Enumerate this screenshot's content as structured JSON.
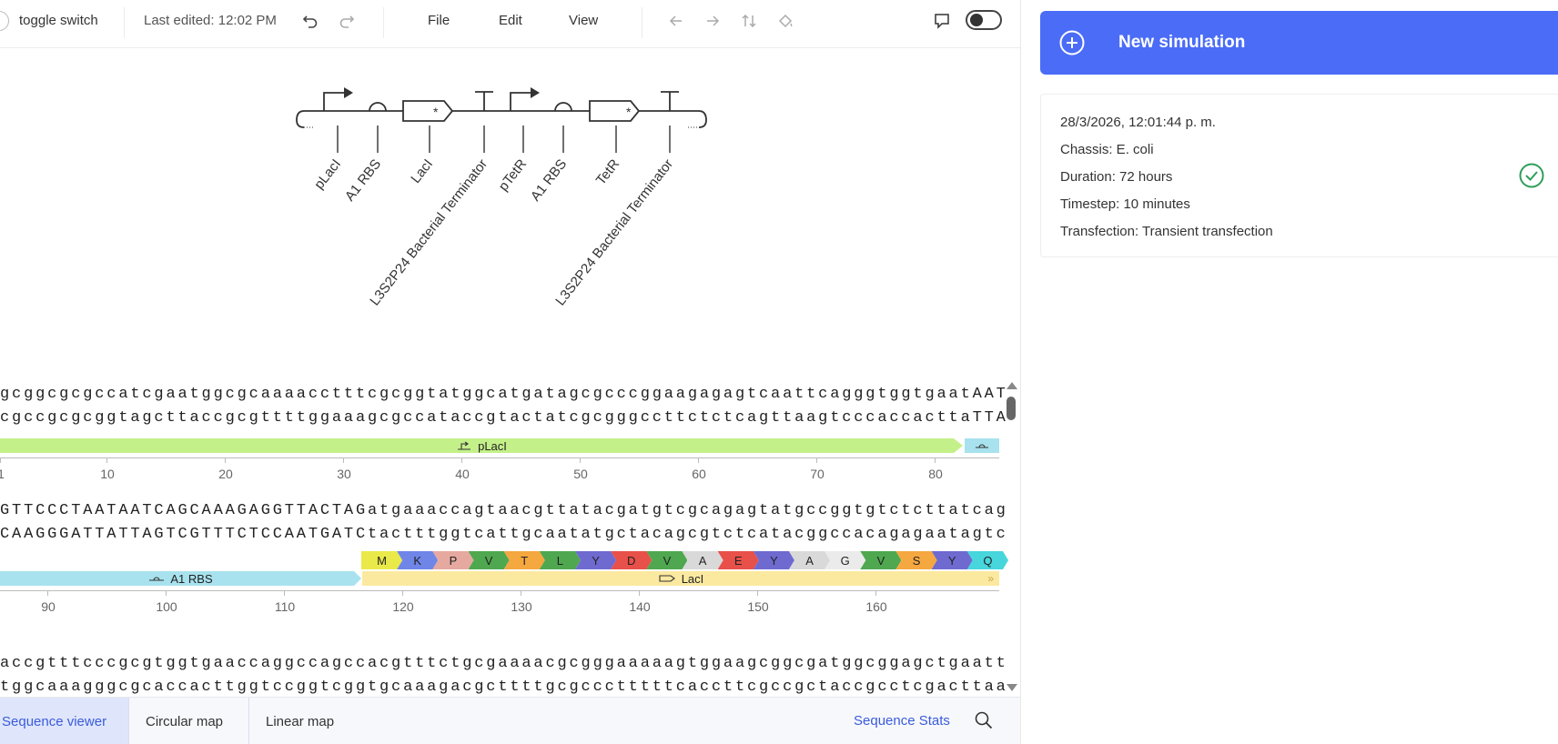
{
  "toolbar": {
    "design_name": "toggle switch",
    "last_edited": "Last edited: 12:02 PM",
    "menus": [
      "File",
      "Edit",
      "View"
    ]
  },
  "diagram": {
    "parts": [
      {
        "label": "pLacI",
        "kind": "promoter"
      },
      {
        "label": "A1 RBS",
        "kind": "rbs"
      },
      {
        "label": "LacI",
        "kind": "cds"
      },
      {
        "label": "L3S2P24 Bacterial Terminator",
        "kind": "terminator"
      },
      {
        "label": "pTetR",
        "kind": "promoter"
      },
      {
        "label": "A1 RBS",
        "kind": "rbs"
      },
      {
        "label": "TetR",
        "kind": "cds"
      },
      {
        "label": "L3S2P24 Bacterial Terminator",
        "kind": "terminator"
      }
    ]
  },
  "sequence": {
    "block1": {
      "top": "gcggcgcgccatcgaatggcgcaaaacctttcgcggtatggcatgatagcgcccggaagagagtcaattcagggtggtgaatAAT",
      "bottom": "cgccgcgcggtagcttaccgcgttttggaaagcgccataccgtactatcgcgggccttctctcagttaagtcccaccacttaTTA",
      "feature": "pLacI",
      "ticks": [
        "1",
        "10",
        "20",
        "30",
        "40",
        "50",
        "60",
        "70",
        "80"
      ]
    },
    "block2": {
      "top": "GTTCCCTAATAATCAGCAAAGAGGTTACTAGatgaaaccagtaacgttatacgatgtcgcagagtatgccggtgtctcttatcag",
      "bottom": "CAAGGGATTATTAGTCGTTTCTCCAATGATCtactttggtcattgcaatatgctacagcgtctcatacggccacagagaatagtc",
      "features": [
        "A1 RBS",
        "LacI"
      ],
      "aminoacids": [
        "M",
        "K",
        "P",
        "V",
        "T",
        "L",
        "Y",
        "D",
        "V",
        "A",
        "E",
        "Y",
        "A",
        "G",
        "V",
        "S",
        "Y",
        "Q"
      ],
      "ticks": [
        "90",
        "100",
        "110",
        "120",
        "130",
        "140",
        "150",
        "160"
      ]
    },
    "block3": {
      "top": "accgtttcccgcgtggtgaaccaggccagccacgtttctgcgaaaacgcgggaaaaagtggaagcggcgatggcggagctgaatt",
      "bottom": "tggcaaagggcgcaccacttggtccggtcggtgcaaagacgcttttgcgccctttttcaccttcgccgctaccgcctcgacttaa"
    }
  },
  "tabs": {
    "items": [
      "Sequence viewer",
      "Circular map",
      "Linear map"
    ],
    "active": "Sequence viewer",
    "stats_link": "Sequence Stats"
  },
  "right_panel": {
    "new_simulation_label": "New simulation",
    "simulation": {
      "date": "28/3/2026, 12:01:44 p. m.",
      "chassis": "Chassis: E. coli",
      "duration": "Duration: 72 hours",
      "timestep": "Timestep: 10 minutes",
      "transfection": "Transfection: Transient transfection",
      "status": "completed"
    }
  },
  "colors": {
    "accent": "#4a6cf7",
    "promoter_feature": "#c4f08a",
    "rbs_feature": "#a8e2ee",
    "cds_feature": "#fbe9a0",
    "success": "#2e9e5b"
  }
}
